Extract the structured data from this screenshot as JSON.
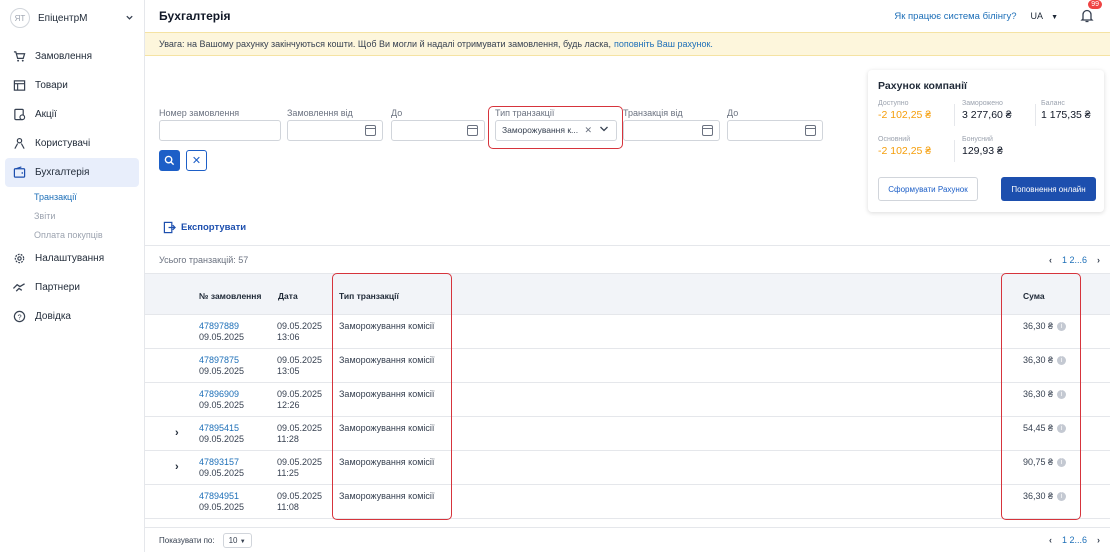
{
  "org": {
    "avatar": "ЯТ",
    "name": "ЕпіцентрМ"
  },
  "sidebar": {
    "items": [
      {
        "label": "Замовлення",
        "icon": "cart-icon"
      },
      {
        "label": "Товари",
        "icon": "box-icon"
      },
      {
        "label": "Акції",
        "icon": "discount-icon"
      },
      {
        "label": "Користувачі",
        "icon": "users-icon"
      },
      {
        "label": "Бухгалтерія",
        "icon": "wallet-icon"
      },
      {
        "label": "Налаштування",
        "icon": "gear-icon"
      },
      {
        "label": "Партнери",
        "icon": "handshake-icon"
      },
      {
        "label": "Довідка",
        "icon": "help-icon"
      }
    ],
    "sub_items": [
      "Транзакції",
      "Звіти",
      "Оплата покупців"
    ]
  },
  "header": {
    "title": "Бухгалтерія",
    "help_link": "Як працює система білінгу?",
    "lang": "UA",
    "notifications": "99"
  },
  "banner": {
    "text": "Увага: на Вашому рахунку закінчуються кошти. Щоб Ви могли й надалі отримувати замовлення, будь ласка,",
    "link": "поповніть Ваш рахунок."
  },
  "filters": {
    "order_number_label": "Номер замовлення",
    "order_from_label": "Замовлення від",
    "order_to_label": "До",
    "type_label": "Тип транзакції",
    "type_value": "Заморожування к...",
    "trans_from_label": "Транзакція від",
    "trans_to_label": "До"
  },
  "card": {
    "title": "Рахунок компанії",
    "available_label": "Доступно",
    "available_value": "-2 102,25 ₴",
    "frozen_label": "Заморожено",
    "frozen_value": "3 277,60 ₴",
    "balance_label": "Баланс",
    "balance_value": "1 175,35 ₴",
    "main_label": "Основний",
    "main_value": "-2 102,25 ₴",
    "bonus_label": "Бонусний",
    "bonus_value": "129,93 ₴",
    "btn_invoice": "Сформувати Рахунок",
    "btn_topup": "Поповнення онлайн"
  },
  "export_label": "Експортувати",
  "total_label": "Усього транзакцій: 57",
  "pager": {
    "text": "1 2...6"
  },
  "table": {
    "headers": {
      "order": "№ замовлення",
      "date": "Дата",
      "type": "Тип транзакції",
      "sum": "Сума"
    },
    "rows": [
      {
        "order": "47897889",
        "order_date": "09.05.2025",
        "date": "09.05.2025",
        "time": "13:06",
        "type": "Заморожування комісії",
        "sum": "36,30 ₴"
      },
      {
        "order": "47897875",
        "order_date": "09.05.2025",
        "date": "09.05.2025",
        "time": "13:05",
        "type": "Заморожування комісії",
        "sum": "36,30 ₴"
      },
      {
        "order": "47896909",
        "order_date": "09.05.2025",
        "date": "09.05.2025",
        "time": "12:26",
        "type": "Заморожування комісії",
        "sum": "36,30 ₴"
      },
      {
        "order": "47895415",
        "order_date": "09.05.2025",
        "date": "09.05.2025",
        "time": "11:28",
        "type": "Заморожування комісії",
        "sum": "54,45 ₴"
      },
      {
        "order": "47893157",
        "order_date": "09.05.2025",
        "date": "09.05.2025",
        "time": "11:25",
        "type": "Заморожування комісії",
        "sum": "90,75 ₴"
      },
      {
        "order": "47894951",
        "order_date": "09.05.2025",
        "date": "09.05.2025",
        "time": "11:08",
        "type": "Заморожування комісії",
        "sum": "36,30 ₴"
      }
    ]
  },
  "footer": {
    "per_page_label": "Показувати по:",
    "per_page_value": "10"
  }
}
